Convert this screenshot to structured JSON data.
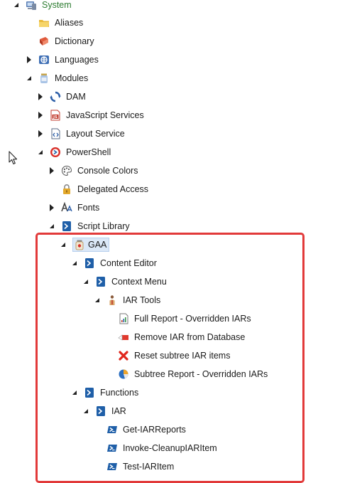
{
  "tree": {
    "items": [
      {
        "label": "System"
      },
      {
        "label": "Aliases"
      },
      {
        "label": "Dictionary"
      },
      {
        "label": "Languages"
      },
      {
        "label": "Modules"
      },
      {
        "label": "DAM"
      },
      {
        "label": "JavaScript Services"
      },
      {
        "label": "Layout Service"
      },
      {
        "label": "PowerShell"
      },
      {
        "label": "Console Colors"
      },
      {
        "label": "Delegated Access"
      },
      {
        "label": "Fonts"
      },
      {
        "label": "Script Library"
      },
      {
        "label": "GAA"
      },
      {
        "label": "Content Editor"
      },
      {
        "label": "Context Menu"
      },
      {
        "label": "IAR Tools"
      },
      {
        "label": "Full Report - Overridden IARs"
      },
      {
        "label": "Remove IAR from Database"
      },
      {
        "label": "Reset subtree IAR items"
      },
      {
        "label": "Subtree Report - Overridden IARs"
      },
      {
        "label": "Functions"
      },
      {
        "label": "IAR"
      },
      {
        "label": "Get-IARReports"
      },
      {
        "label": "Invoke-CleanupIARItem"
      },
      {
        "label": "Test-IARItem"
      }
    ]
  },
  "colors": {
    "highlight_border": "#e23a3a",
    "selected_background": "#dbe8f7",
    "system_label": "#2e7d32",
    "powershell_blue": "#1f5fa8"
  }
}
